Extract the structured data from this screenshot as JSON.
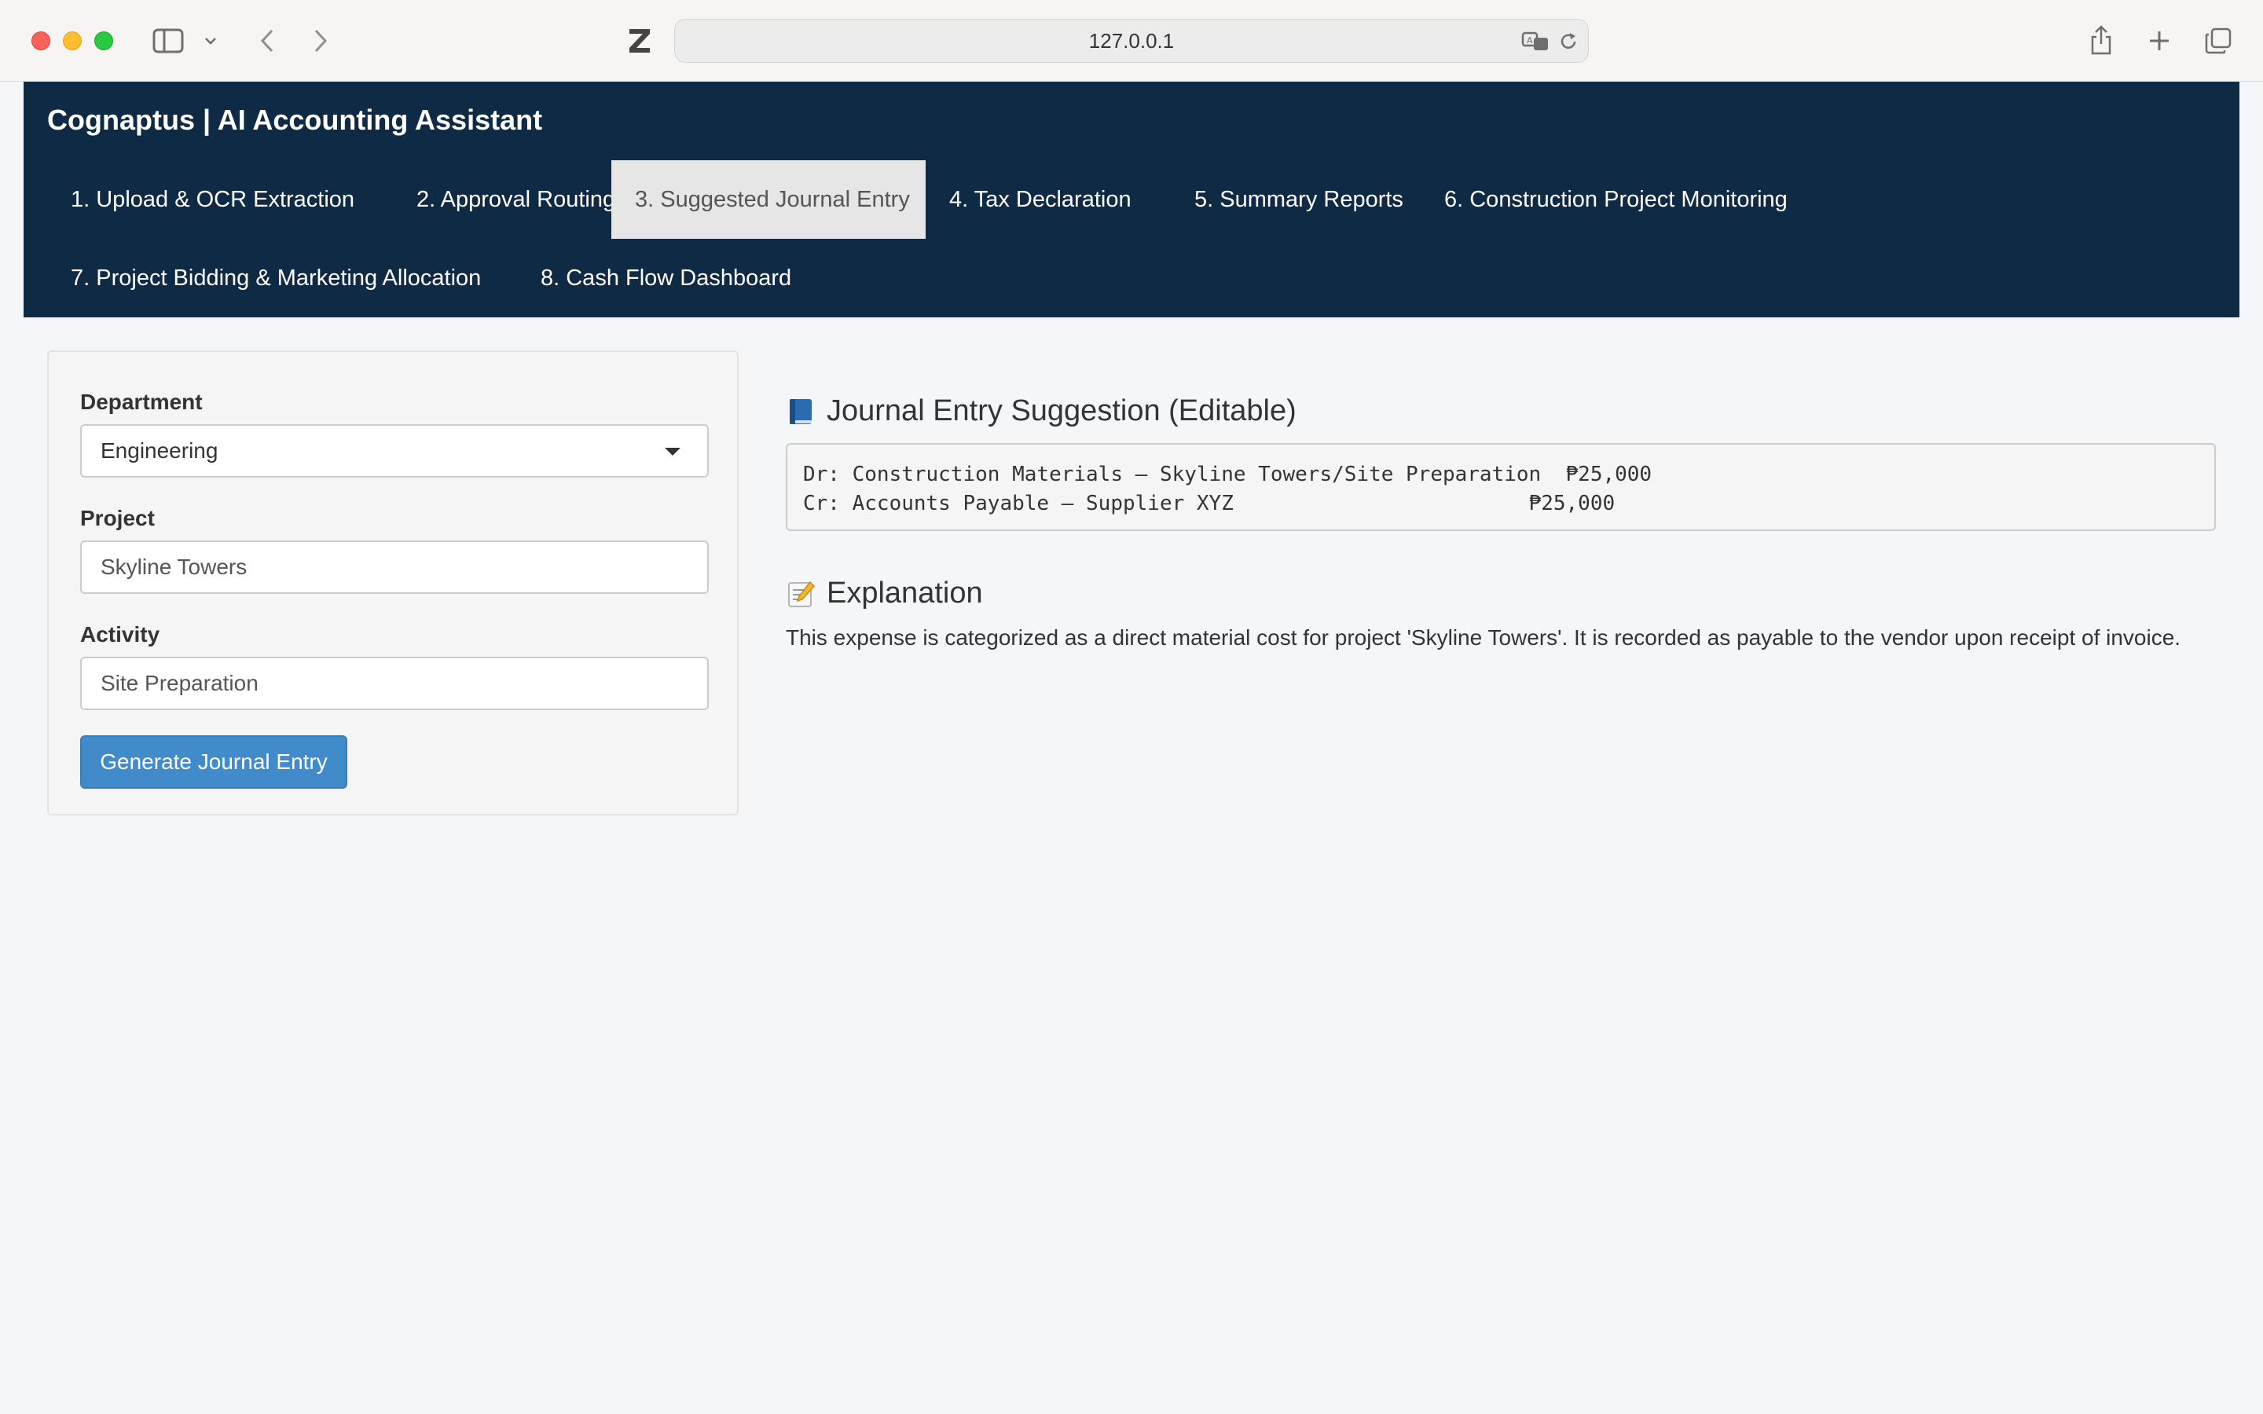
{
  "browser": {
    "url": "127.0.0.1"
  },
  "app": {
    "brand": "Cognaptus | AI Accounting Assistant",
    "tabs": [
      {
        "label": "1. Upload & OCR Extraction",
        "active": false
      },
      {
        "label": "2. Approval Routing",
        "active": false
      },
      {
        "label": "3. Suggested Journal Entry",
        "active": true
      },
      {
        "label": "4. Tax Declaration",
        "active": false
      },
      {
        "label": "5. Summary Reports",
        "active": false
      },
      {
        "label": "6. Construction Project Monitoring",
        "active": false
      },
      {
        "label": "7. Project Bidding & Marketing Allocation",
        "active": false
      },
      {
        "label": "8. Cash Flow Dashboard",
        "active": false
      }
    ]
  },
  "form": {
    "department_label": "Department",
    "department_value": "Engineering",
    "project_label": "Project",
    "project_value": "Skyline Towers",
    "activity_label": "Activity",
    "activity_value": "Site Preparation",
    "generate_label": "Generate Journal Entry"
  },
  "journal": {
    "title": "Journal Entry Suggestion (Editable)",
    "entry_text": "Dr: Construction Materials – Skyline Towers/Site Preparation  ₱25,000\nCr: Accounts Payable – Supplier XYZ                        ₱25,000"
  },
  "explanation": {
    "title": "Explanation",
    "text": "This expense is categorized as a direct material cost for project 'Skyline Towers'. It is recorded as payable to the vendor upon receipt of invoice."
  },
  "colors": {
    "navbar": "#0f2a44",
    "button": "#428bca",
    "active_tab": "#e6e6e6"
  }
}
